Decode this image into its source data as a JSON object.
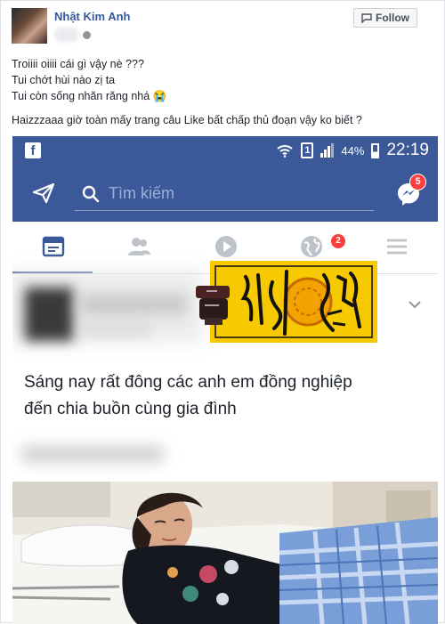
{
  "post": {
    "author": "Nhật Kim Anh",
    "follow_label": "Follow",
    "caption_lines": [
      "Troiiii oiiii cái gì vậy nè ???",
      "Tui chớt hùi nào zị ta",
      "Tui còn sống nhăn răng nhá 😭",
      "Haizzzaaa giờ toàn mấy trang câu Like bất chấp thủ đoạn vậy ko biết ?"
    ]
  },
  "screenshot": {
    "status_bar": {
      "battery": "44%",
      "time": "22:19",
      "sim": "1"
    },
    "search_placeholder": "Tìm kiếm",
    "messenger_badge": "5",
    "notifications_badge": "2",
    "inner_post_lines": [
      "Sáng nay rất đông các anh em đồng nghiệp",
      "đến chia buồn   cùng   gia  đình"
    ]
  },
  "colors": {
    "facebook_blue": "#3b5998",
    "badge_red": "#fa3e3e",
    "ticket_yellow": "#f7c900"
  }
}
